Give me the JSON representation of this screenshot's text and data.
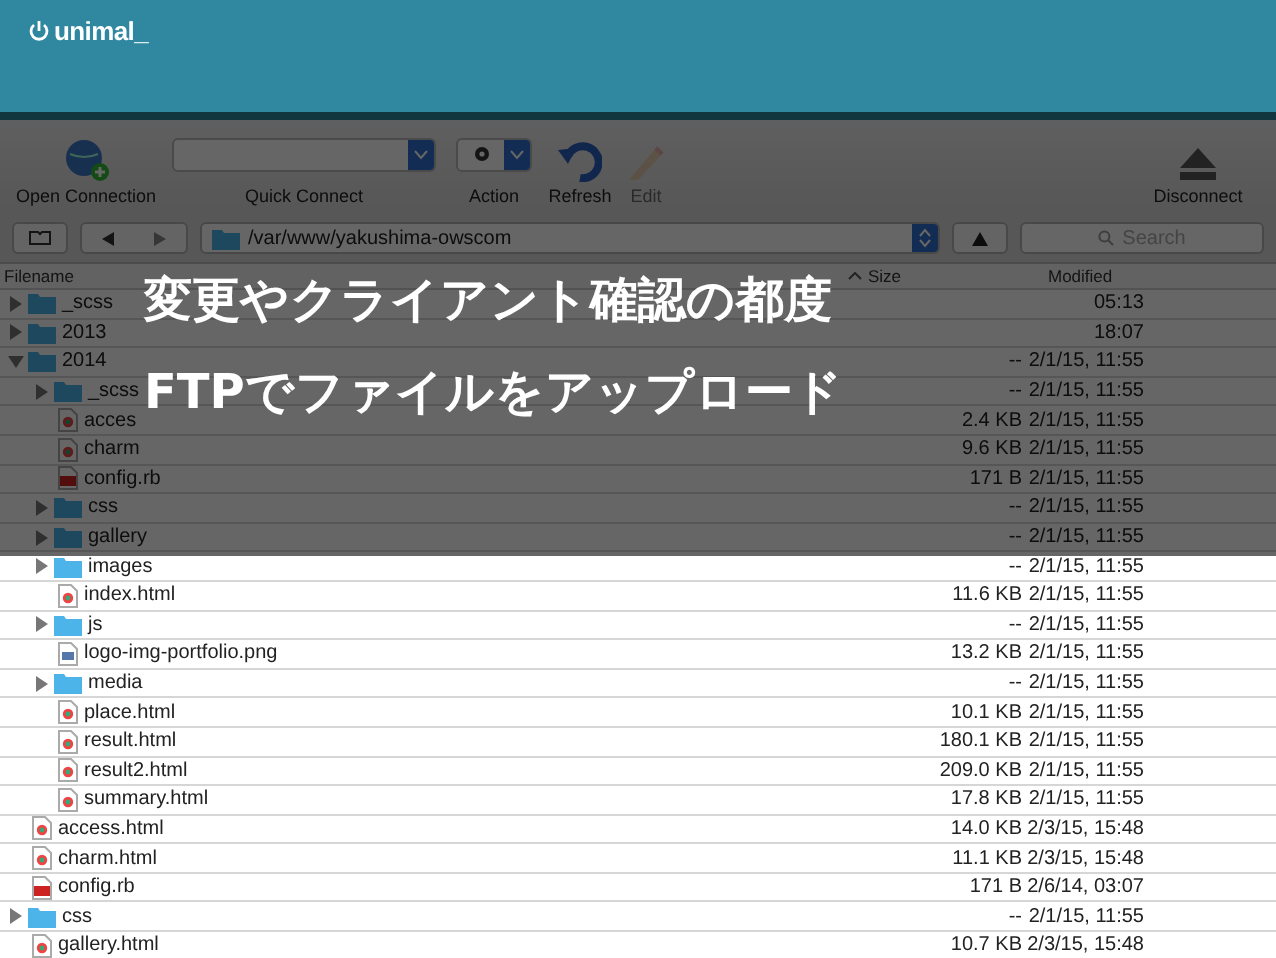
{
  "header": {
    "logo": "unimal_"
  },
  "toolbar": {
    "items": [
      {
        "kind": "open",
        "label": "Open Connection",
        "disabled": false
      },
      {
        "kind": "combo",
        "label": "Quick Connect",
        "disabled": false
      },
      {
        "kind": "action",
        "label": "Action",
        "disabled": false
      },
      {
        "kind": "refresh",
        "label": "Refresh",
        "disabled": false
      },
      {
        "kind": "edit",
        "label": "Edit",
        "disabled": true
      },
      {
        "kind": "disconnect",
        "label": "Disconnect",
        "disabled": false
      }
    ]
  },
  "path_bar": {
    "path": "/var/www/yakushima-owscom",
    "search_placeholder": "Search"
  },
  "columns": [
    {
      "label": "Filename",
      "sorted": false
    },
    {
      "label": "Size",
      "sorted": true
    },
    {
      "label": "Modified",
      "sorted": false
    }
  ],
  "files": [
    {
      "name": "_scss",
      "kind": "folder",
      "expanded": false,
      "modified": "05:13"
    },
    {
      "name": "2013",
      "kind": "folder",
      "expanded": false,
      "modified": "18:07"
    },
    {
      "name": "2014",
      "kind": "folder",
      "expanded": true,
      "size": "--",
      "modified": "2/1/15, 11:55",
      "children": [
        {
          "name": "_scss",
          "kind": "folder",
          "expanded": false,
          "size": "--",
          "modified": "2/1/15, 11:55"
        },
        {
          "name": "acces",
          "kind": "html",
          "size": "2.4 KB",
          "modified": "2/1/15, 11:55"
        },
        {
          "name": "charm",
          "kind": "html",
          "size": "9.6 KB",
          "modified": "2/1/15, 11:55"
        },
        {
          "name": "config.rb",
          "kind": "rb",
          "size": "171 B",
          "modified": "2/1/15, 11:55"
        },
        {
          "name": "css",
          "kind": "folder",
          "expanded": false,
          "size": "--",
          "modified": "2/1/15, 11:55"
        },
        {
          "name": "gallery",
          "kind": "folder",
          "expanded": false,
          "size": "--",
          "modified": "2/1/15, 11:55"
        },
        {
          "name": "images",
          "kind": "folder",
          "expanded": false,
          "size": "--",
          "modified": "2/1/15, 11:55"
        },
        {
          "name": "index.html",
          "kind": "html",
          "size": "11.6 KB",
          "modified": "2/1/15, 11:55"
        },
        {
          "name": "js",
          "kind": "folder",
          "expanded": false,
          "size": "--",
          "modified": "2/1/15, 11:55"
        },
        {
          "name": "logo-img-portfolio.png",
          "kind": "png",
          "size": "13.2 KB",
          "modified": "2/1/15, 11:55"
        },
        {
          "name": "media",
          "kind": "folder",
          "expanded": false,
          "size": "--",
          "modified": "2/1/15, 11:55"
        },
        {
          "name": "place.html",
          "kind": "html",
          "size": "10.1 KB",
          "modified": "2/1/15, 11:55"
        },
        {
          "name": "result.html",
          "kind": "html",
          "size": "180.1 KB",
          "modified": "2/1/15, 11:55"
        },
        {
          "name": "result2.html",
          "kind": "html",
          "size": "209.0 KB",
          "modified": "2/1/15, 11:55"
        },
        {
          "name": "summary.html",
          "kind": "html",
          "size": "17.8 KB",
          "modified": "2/1/15, 11:55"
        }
      ]
    },
    {
      "name": "access.html",
      "kind": "html",
      "size": "14.0 KB",
      "modified": "2/3/15, 15:48"
    },
    {
      "name": "charm.html",
      "kind": "html",
      "size": "11.1 KB",
      "modified": "2/3/15, 15:48"
    },
    {
      "name": "config.rb",
      "kind": "rb",
      "size": "171 B",
      "modified": "2/6/14, 03:07"
    },
    {
      "name": "css",
      "kind": "folder",
      "expanded": false,
      "size": "--",
      "modified": "2/1/15, 11:55"
    },
    {
      "name": "gallery.html",
      "kind": "html",
      "size": "10.7 KB",
      "modified": "2/3/15, 15:48"
    }
  ],
  "overlay_title": [
    "変更やクライアント確認の都度",
    "FTPでファイルをアップロード"
  ]
}
